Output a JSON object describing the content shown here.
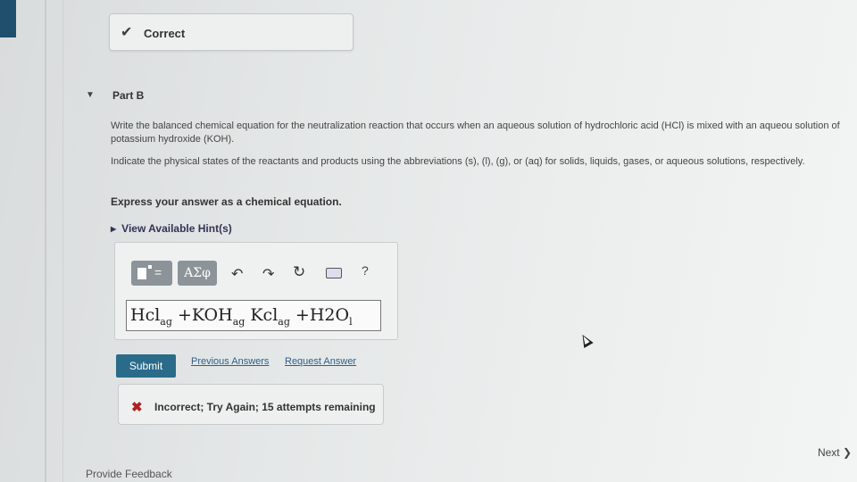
{
  "status": {
    "check_symbol": "✔",
    "correct_label": "Correct"
  },
  "part": {
    "toggle_symbol": "▼",
    "title": "Part B"
  },
  "question": {
    "text": "Write the balanced chemical equation for the neutralization reaction that occurs when an aqueous solution of hydrochloric acid (HCl) is mixed with an aqueou solution of potassium hydroxide (KOH).",
    "states": "Indicate the physical states of the reactants and products using the abbreviations (s), (l), (g), or (aq) for solids, liquids, gases, or aqueous solutions, respectively.",
    "instruction": "Express your answer as a chemical equation.",
    "hints_label": "View Available Hint(s)",
    "hints_symbol": "▶"
  },
  "toolbar": {
    "templates_eq": "=",
    "greek_label": "ΑΣφ",
    "undo_symbol": "↶",
    "redo_symbol": "↷",
    "reset_symbol": "↻",
    "help_symbol": "?"
  },
  "answer": {
    "hcl": "Hcl",
    "hcl_sub": "ag",
    "plus1": " +",
    "koh": "KOH",
    "koh_sub": "ag",
    "kcl": " Kcl",
    "kcl_sub": "ag",
    "plus2": " +",
    "h2o": "H2O",
    "h2o_sub": "l"
  },
  "actions": {
    "submit": "Submit",
    "previous_answers": "Previous Answers",
    "request_answer": "Request Answer"
  },
  "feedback": {
    "x_symbol": "✖",
    "message": "Incorrect; Try Again; 15 attempts remaining"
  },
  "navigation": {
    "next": "Next ❯"
  },
  "footer": {
    "provide_feedback": "Provide Feedback"
  }
}
